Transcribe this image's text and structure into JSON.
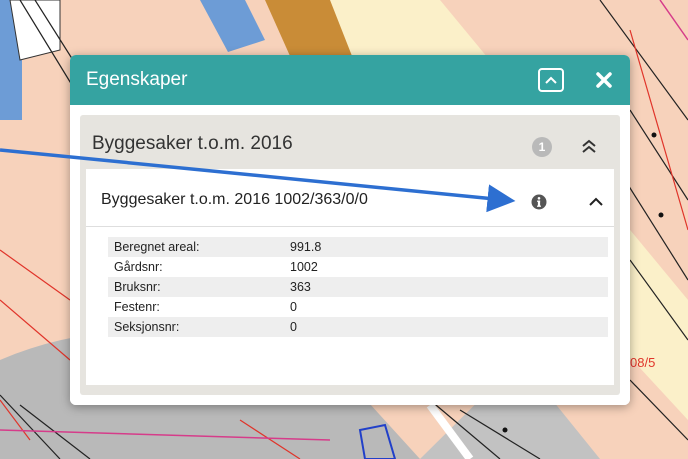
{
  "map": {
    "parcel_label": "08/5"
  },
  "popup": {
    "title": "Egenskaper",
    "collapse_icon": "chevron-up-icon",
    "close_icon": "close-icon",
    "layer": {
      "title": "Byggesaker t.o.m. 2016",
      "count": "1",
      "toggle_icon": "double-chevron-up-icon",
      "feature": {
        "title": "Byggesaker t.o.m. 2016 1002/363/0/0",
        "info_icon": "info-icon",
        "toggle_icon": "chevron-up-icon",
        "attributes": [
          {
            "key": "Beregnet areal:",
            "value": "991.8"
          },
          {
            "key": "Gårdsnr:",
            "value": "1002"
          },
          {
            "key": "Bruksnr:",
            "value": "363"
          },
          {
            "key": "Festenr:",
            "value": "0"
          },
          {
            "key": "Seksjonsnr:",
            "value": "0"
          }
        ]
      }
    }
  },
  "colors": {
    "header": "#35a3a1",
    "annotation_arrow": "#2d6fd1",
    "map_background": "#f7d2bb"
  }
}
